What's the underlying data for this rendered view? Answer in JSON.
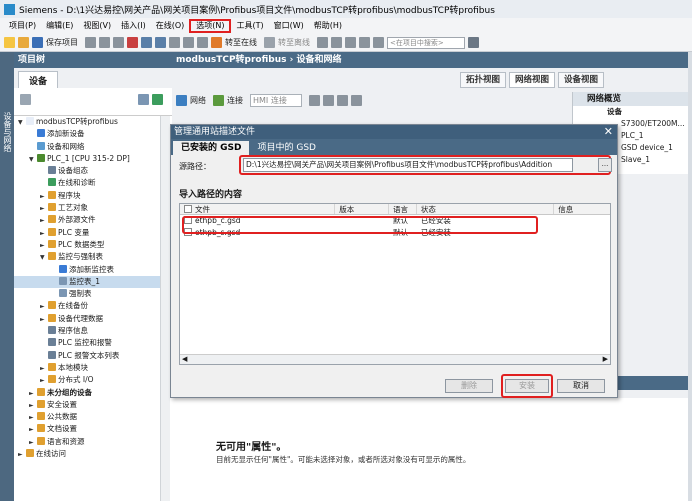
{
  "window": {
    "title": "Siemens - D:\\1兴达易控\\网关产品\\网关项目案例\\Profibus项目文件\\modbusTCP转profibus\\modbusTCP转profibus"
  },
  "menu": {
    "items": [
      "项目(P)",
      "编辑(E)",
      "视图(V)",
      "插入(I)",
      "在线(O)",
      "选项(N)",
      "工具(T)",
      "窗口(W)",
      "帮助(H)"
    ]
  },
  "toolbar": {
    "save_label": "保存项目",
    "online_label": "转至在线",
    "offline_label": "转至离线",
    "search_placeholder": "<在项目中搜索>"
  },
  "sidebar": {
    "strip_label": "设备与网络"
  },
  "project_tree": {
    "title": "项目树",
    "devices_tab": "设备",
    "items": [
      {
        "label": "modbusTCP转profibus",
        "indent": 0,
        "arrow": "▼",
        "color": "#e8eef8"
      },
      {
        "label": "添加新设备",
        "indent": 1,
        "arrow": "",
        "color": "#3a7bd5"
      },
      {
        "label": "设备和网络",
        "indent": 1,
        "arrow": "",
        "color": "#5a9bd0"
      },
      {
        "label": "PLC_1 [CPU 315-2 DP]",
        "indent": 1,
        "arrow": "▼",
        "color": "#4b8a2e"
      },
      {
        "label": "设备组态",
        "indent": 2,
        "arrow": "",
        "color": "#6a7f96"
      },
      {
        "label": "在线和诊断",
        "indent": 2,
        "arrow": "",
        "color": "#3c9d5d"
      },
      {
        "label": "程序块",
        "indent": 2,
        "arrow": "►",
        "color": "#e0a030"
      },
      {
        "label": "工艺对象",
        "indent": 2,
        "arrow": "►",
        "color": "#e0a030"
      },
      {
        "label": "外部源文件",
        "indent": 2,
        "arrow": "►",
        "color": "#e0a030"
      },
      {
        "label": "PLC 变量",
        "indent": 2,
        "arrow": "►",
        "color": "#e0a030"
      },
      {
        "label": "PLC 数据类型",
        "indent": 2,
        "arrow": "►",
        "color": "#e0a030"
      },
      {
        "label": "监控与强制表",
        "indent": 2,
        "arrow": "▼",
        "color": "#e0a030"
      },
      {
        "label": "添加新监控表",
        "indent": 3,
        "arrow": "",
        "color": "#3a7bd5"
      },
      {
        "label": "监控表_1",
        "indent": 3,
        "arrow": "",
        "color": "#7b96b3",
        "selected": true
      },
      {
        "label": "强制表",
        "indent": 3,
        "arrow": "",
        "color": "#7b96b3"
      },
      {
        "label": "在线备份",
        "indent": 2,
        "arrow": "►",
        "color": "#e0a030"
      },
      {
        "label": "设备代理数据",
        "indent": 2,
        "arrow": "►",
        "color": "#e0a030"
      },
      {
        "label": "程序信息",
        "indent": 2,
        "arrow": "",
        "color": "#6a7f96"
      },
      {
        "label": "PLC 监控和报警",
        "indent": 2,
        "arrow": "",
        "color": "#6a7f96"
      },
      {
        "label": "PLC 报警文本列表",
        "indent": 2,
        "arrow": "",
        "color": "#6a7f96"
      },
      {
        "label": "本地模块",
        "indent": 2,
        "arrow": "►",
        "color": "#e0a030"
      },
      {
        "label": "分布式 I/O",
        "indent": 2,
        "arrow": "►",
        "color": "#e0a030"
      },
      {
        "label": "未分组的设备",
        "indent": 1,
        "arrow": "►",
        "color": "#e0a030",
        "bold": true
      },
      {
        "label": "安全设置",
        "indent": 1,
        "arrow": "►",
        "color": "#e0a030"
      },
      {
        "label": "公共数据",
        "indent": 1,
        "arrow": "►",
        "color": "#e0a030"
      },
      {
        "label": "文档设置",
        "indent": 1,
        "arrow": "►",
        "color": "#e0a030"
      },
      {
        "label": "语言和资源",
        "indent": 1,
        "arrow": "►",
        "color": "#e0a030"
      },
      {
        "label": "在线访问",
        "indent": 0,
        "arrow": "►",
        "color": "#e0a030"
      }
    ]
  },
  "editor": {
    "breadcrumb": "modbusTCP转profibus  ›  设备和网络",
    "views": [
      "拓扑视图",
      "网络视图",
      "设备视图"
    ],
    "net_tools": {
      "network": "网络",
      "connect": "连接",
      "hmi_conn": "HMI 连接"
    },
    "overview": {
      "title": "网络概览",
      "device_col": "设备",
      "rows": [
        "S7300/ET200M...",
        "PLC_1",
        "GSD device_1",
        "Slave_1"
      ]
    }
  },
  "dialog": {
    "title": "管理通用站描述文件",
    "tabs": [
      "已安装的 GSD",
      "项目中的 GSD"
    ],
    "source_label": "源路径：",
    "source_path": "D:\\1兴达易控\\网关产品\\网关项目案例\\Profibus项目文件\\modbusTCP转profibus\\Addition",
    "import_heading": "导入路径的内容",
    "columns": [
      "文件",
      "版本",
      "语言",
      "状态",
      "信息"
    ],
    "rows": [
      {
        "file": "ethpb_c.gsd",
        "version": "",
        "language": "默认",
        "status": "已经安装",
        "info": ""
      },
      {
        "file": "ethpb_s.gsd",
        "version": "",
        "language": "默认",
        "status": "已经安装",
        "info": ""
      }
    ],
    "buttons": {
      "delete": "删除",
      "install": "安装",
      "cancel": "取消"
    }
  },
  "properties": {
    "title": "无可用\"属性\"。",
    "desc": "目前无显示任何\"属性\"。可能未选择对象，或者所选对象没有可显示的属性。"
  }
}
